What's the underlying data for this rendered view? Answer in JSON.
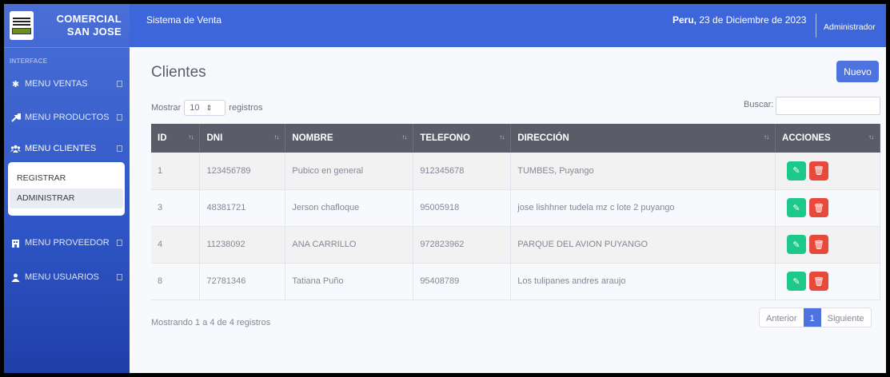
{
  "sidebar": {
    "brand": {
      "line1": "COMERCIAL",
      "line2": "SAN JOSE"
    },
    "heading": "INTERFACE",
    "items": [
      {
        "label": "MENU VENTAS",
        "icon": "cog-icon"
      },
      {
        "label": "MENU PRODUCTOS",
        "icon": "wrench-icon"
      },
      {
        "label": "MENU CLIENTES",
        "icon": "users-icon"
      },
      {
        "label": "MENU PROVEEDOR",
        "icon": "building-icon"
      },
      {
        "label": "MENU USUARIOS",
        "icon": "user-icon"
      }
    ],
    "submenu": [
      "REGISTRAR",
      "ADMINISTRAR"
    ]
  },
  "topbar": {
    "system": "Sistema de Venta",
    "country": "Peru,",
    "date": " 23 de Diciembre de 2023",
    "user": "Administrador"
  },
  "page": {
    "title": "Clientes",
    "new_button": "Nuevo",
    "show_label": "Mostrar",
    "show_value": "10",
    "records_label": "registros",
    "search_label": "Buscar:",
    "info": "Mostrando 1 a 4 de 4 registros",
    "pager": {
      "prev": "Anterior",
      "current": "1",
      "next": "Siguiente"
    }
  },
  "table": {
    "headers": [
      "ID",
      "DNI",
      "NOMBRE",
      "TELEFONO",
      "DIRECCIÓN",
      "ACCIONES"
    ],
    "rows": [
      [
        "1",
        "123456789",
        "Pubico en general",
        "912345678",
        "TUMBES, Puyango"
      ],
      [
        "3",
        "48381721",
        "Jerson chafloque",
        "95005918",
        "jose lishhner tudela mz c lote 2 puyango"
      ],
      [
        "4",
        "11238092",
        "ANA CARRILLO",
        "972823962",
        "PARQUE DEL AVION PUYANGO"
      ],
      [
        "8",
        "72781346",
        "Tatiana Puño",
        "95408789",
        "Los tulipanes andres araujo"
      ]
    ]
  },
  "colors": {
    "primary": "#4e73df",
    "edit": "#1cc88a",
    "delete": "#e74a3b",
    "header": "#5a5c69"
  }
}
